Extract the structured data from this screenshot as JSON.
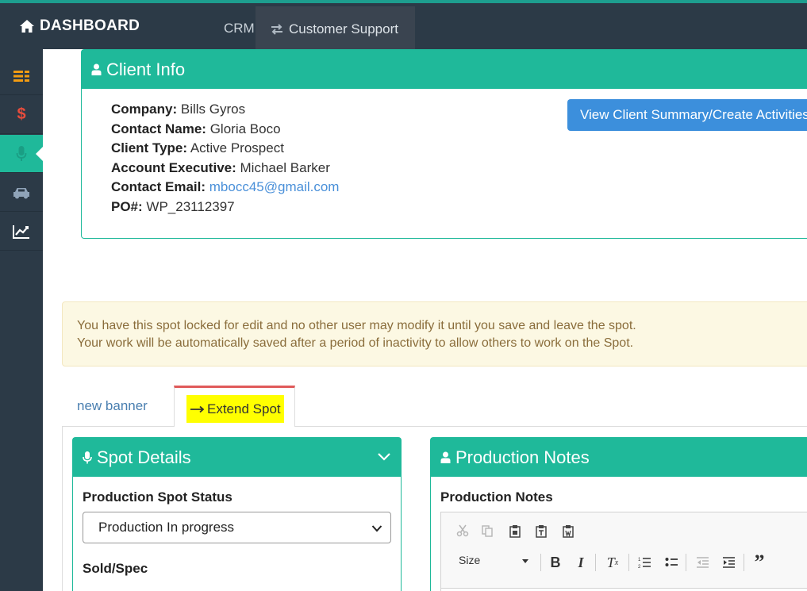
{
  "header": {
    "brand_label": "DASHBOARD",
    "brand_icon": "home-icon",
    "nav_crm": "CRM",
    "nav_customer_support": "Customer Support",
    "nav_customer_support_icon": "exchange-arrows-icon",
    "accent_color": "#1fb99a",
    "bar_color": "#2c3a47"
  },
  "sidebar": {
    "items": [
      {
        "icon": "list-icon",
        "color": "#f39c12"
      },
      {
        "icon": "dollar-icon",
        "color": "#e74c3c"
      },
      {
        "icon": "microphone-icon",
        "color": "#1fb99a",
        "active": true
      },
      {
        "icon": "car-icon",
        "color": "#8fa3b8"
      },
      {
        "icon": "line-chart-icon",
        "color": "#ffffff"
      }
    ]
  },
  "client_info": {
    "title": "Client Info",
    "icon": "user-icon",
    "company_label": "Company:",
    "company_value": "Bills Gyros",
    "contact_name_label": "Contact Name:",
    "contact_name_value": "Gloria Boco",
    "client_type_label": "Client Type:",
    "client_type_value": "Active Prospect",
    "account_exec_label": "Account Executive:",
    "account_exec_value": "Michael Barker",
    "contact_email_label": "Contact Email:",
    "contact_email_value": "mbocc45@gmail.com",
    "po_label": "PO#:",
    "po_value": "WP_23112397",
    "summary_button": "View Client Summary/Create Activities"
  },
  "alert": {
    "line1": "You have this spot locked for edit and no other user may modify it until you save and leave the spot.",
    "line2": "Your work will be automatically saved after a period of inactivity to allow others to work on the Spot."
  },
  "tabs": {
    "new_banner": "new banner",
    "extend_spot": "Extend Spot",
    "extend_spot_icon": "long-arrow-right-icon"
  },
  "spot_details": {
    "title": "Spot Details",
    "icon": "microphone-icon",
    "status_label": "Production Spot Status",
    "status_value": "Production In progress",
    "sold_spec_label": "Sold/Spec"
  },
  "production_notes": {
    "title": "Production Notes",
    "icon": "user-icon",
    "field_label": "Production Notes",
    "size_label": "Size"
  }
}
